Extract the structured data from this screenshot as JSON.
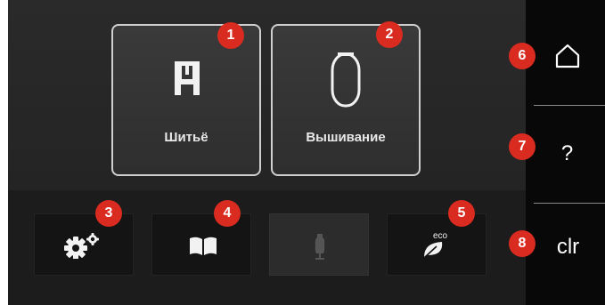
{
  "main_tiles": [
    {
      "label": "Шитьё",
      "icon": "presser-foot-icon",
      "badge": "1"
    },
    {
      "label": "Вышивание",
      "icon": "embroidery-hoop-icon",
      "badge": "2"
    }
  ],
  "bottom_buttons": [
    {
      "icon": "settings-gears-icon",
      "badge": "3",
      "enabled": true
    },
    {
      "icon": "book-icon",
      "badge": "4",
      "enabled": true
    },
    {
      "icon": "dress-form-icon",
      "badge": "",
      "enabled": false
    },
    {
      "icon": "eco-leaf-icon",
      "icon_text": "eco",
      "badge": "5",
      "enabled": true
    }
  ],
  "sidebar": [
    {
      "icon": "home-icon",
      "badge": "6"
    },
    {
      "label": "?",
      "icon": "help-icon",
      "badge": "7"
    },
    {
      "label": "clr",
      "icon": "clear-icon",
      "badge": "8"
    }
  ],
  "colors": {
    "badge": "#d92b1f",
    "background": "#1e1e1e",
    "sidebar": "#080808",
    "tile_border": "#cfcfcf"
  }
}
